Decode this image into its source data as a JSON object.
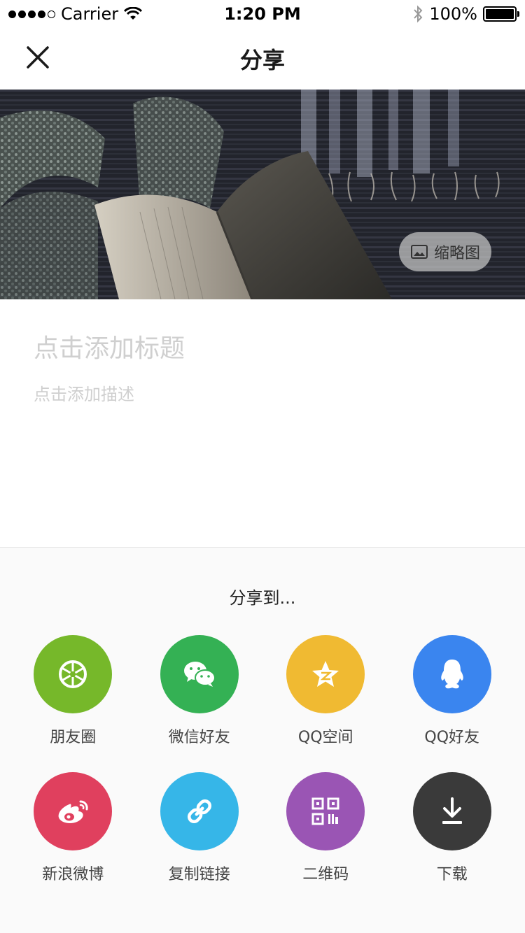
{
  "status_bar": {
    "carrier": "Carrier",
    "time": "1:20 PM",
    "battery": "100%"
  },
  "nav": {
    "title": "分享"
  },
  "cover": {
    "thumbnail_label": "缩略图"
  },
  "form": {
    "title_placeholder": "点击添加标题",
    "description_placeholder": "点击添加描述"
  },
  "share": {
    "heading": "分享到...",
    "items": [
      {
        "label": "朋友圈",
        "icon": "moments-icon",
        "color": "#76b82a"
      },
      {
        "label": "微信好友",
        "icon": "wechat-icon",
        "color": "#34b154"
      },
      {
        "label": "QQ空间",
        "icon": "qzone-icon",
        "color": "#f0ba32"
      },
      {
        "label": "QQ好友",
        "icon": "qq-icon",
        "color": "#3a85ef"
      },
      {
        "label": "新浪微博",
        "icon": "weibo-icon",
        "color": "#e0405e"
      },
      {
        "label": "复制链接",
        "icon": "link-icon",
        "color": "#36b6e8"
      },
      {
        "label": "二维码",
        "icon": "qrcode-icon",
        "color": "#9a55b4"
      },
      {
        "label": "下载",
        "icon": "download-icon",
        "color": "#3a3a3a"
      }
    ]
  }
}
